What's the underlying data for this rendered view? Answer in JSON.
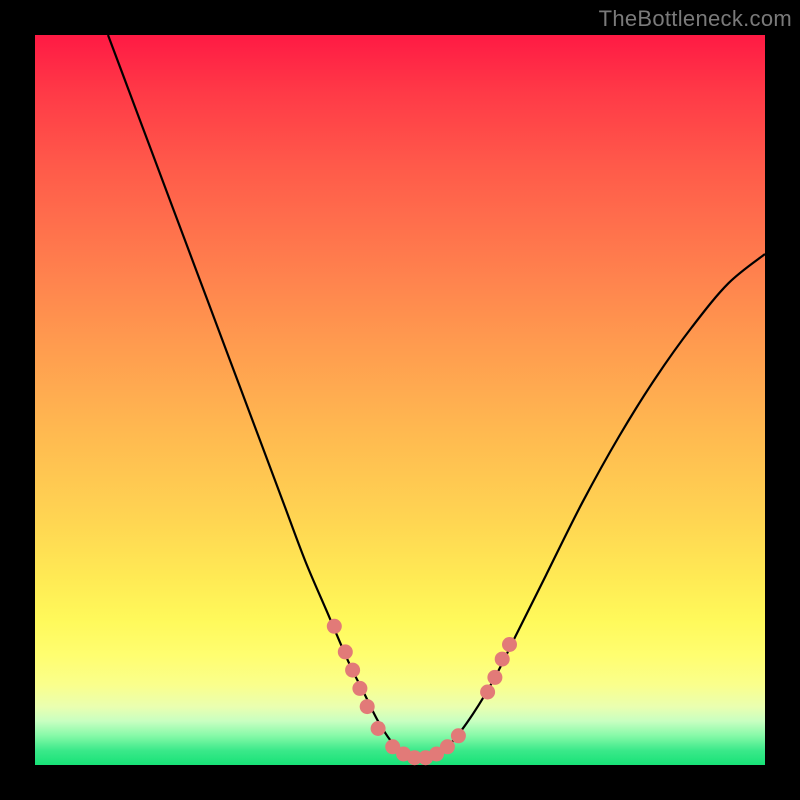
{
  "watermark": "TheBottleneck.com",
  "colors": {
    "background": "#000000",
    "curve": "#000000",
    "marker": "#e27a78",
    "watermark": "#7a7a7a"
  },
  "chart_data": {
    "type": "line",
    "title": "",
    "xlabel": "",
    "ylabel": "",
    "xlim": [
      0,
      100
    ],
    "ylim": [
      0,
      100
    ],
    "grid": false,
    "legend": false,
    "series": [
      {
        "name": "curve",
        "x": [
          10,
          13,
          16,
          19,
          22,
          25,
          28,
          31,
          34,
          37,
          40,
          43,
          45,
          47,
          49,
          51,
          53,
          55,
          57,
          60,
          63,
          66,
          70,
          75,
          80,
          85,
          90,
          95,
          100
        ],
        "y": [
          100,
          92,
          84,
          76,
          68,
          60,
          52,
          44,
          36,
          28,
          21,
          14,
          10,
          6,
          3,
          1.5,
          1,
          1.5,
          3,
          7,
          12,
          18,
          26,
          36,
          45,
          53,
          60,
          66,
          70
        ]
      }
    ],
    "markers": [
      {
        "x": 41,
        "y": 19
      },
      {
        "x": 42.5,
        "y": 15.5
      },
      {
        "x": 43.5,
        "y": 13
      },
      {
        "x": 44.5,
        "y": 10.5
      },
      {
        "x": 45.5,
        "y": 8
      },
      {
        "x": 47,
        "y": 5
      },
      {
        "x": 49,
        "y": 2.5
      },
      {
        "x": 50.5,
        "y": 1.5
      },
      {
        "x": 52,
        "y": 1
      },
      {
        "x": 53.5,
        "y": 1
      },
      {
        "x": 55,
        "y": 1.5
      },
      {
        "x": 56.5,
        "y": 2.5
      },
      {
        "x": 58,
        "y": 4
      },
      {
        "x": 62,
        "y": 10
      },
      {
        "x": 63,
        "y": 12
      },
      {
        "x": 64,
        "y": 14.5
      },
      {
        "x": 65,
        "y": 16.5
      }
    ]
  }
}
